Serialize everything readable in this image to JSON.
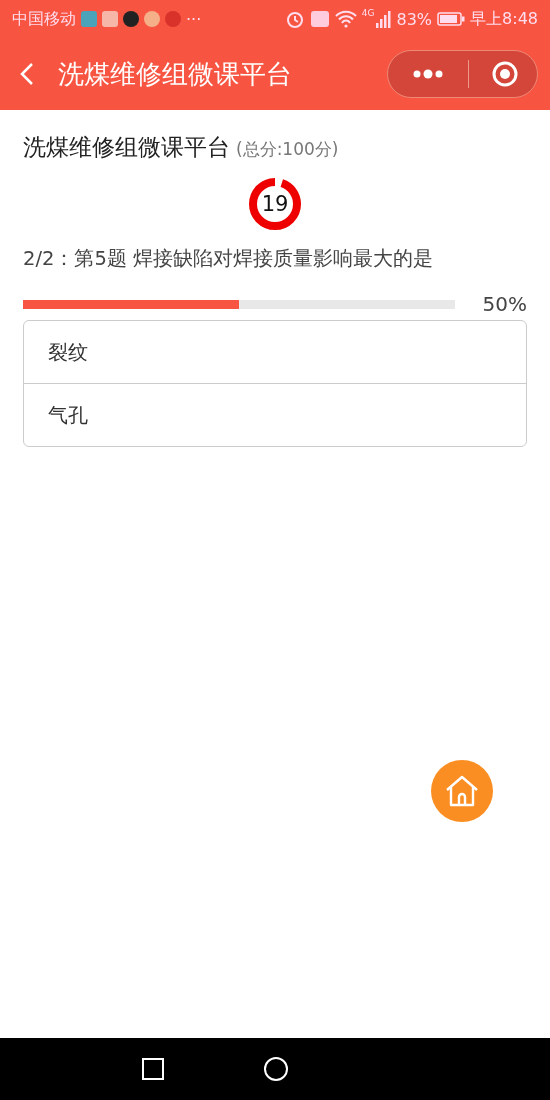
{
  "status_bar": {
    "carrier": "中国移动",
    "more": "···",
    "network": "4G",
    "battery_text": "83%",
    "time": "早上8:48"
  },
  "nav": {
    "title": "洗煤维修组微课平台"
  },
  "quiz": {
    "title": "洗煤维修组微课平台",
    "score_note": "(总分:100分)",
    "timer": "19",
    "question": "2/2：第5题 焊接缺陷对焊接质量影响最大的是",
    "progress": {
      "level": 0.5,
      "reading": "50%"
    },
    "options": [
      {
        "label": "裂纹"
      },
      {
        "label": "气孔"
      }
    ]
  }
}
